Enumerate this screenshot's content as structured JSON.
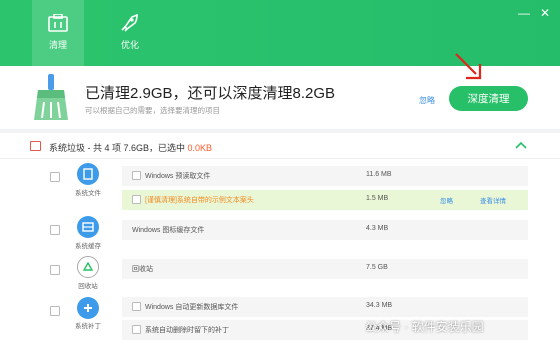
{
  "tabs": [
    {
      "label": "清理",
      "icon": "clean-icon",
      "active": true
    },
    {
      "label": "优化",
      "icon": "rocket-icon",
      "active": false
    }
  ],
  "window_controls": {
    "minimize": "—",
    "close": "✕"
  },
  "summary": {
    "title": "已清理2.9GB，还可以深度清理8.2GB",
    "subtitle": "可以根据自己的需要，选择要清理的项目",
    "ignore_link": "忽略",
    "deep_clean_button": "深度清理"
  },
  "section": {
    "title_prefix": "系统垃圾 - 共 4 项 7.6GB，已选中 ",
    "selected": "0.0KB"
  },
  "categories": [
    {
      "label": "系统文件",
      "icon": "system-file-icon"
    },
    {
      "label": "系统缓存",
      "icon": "system-cache-icon"
    },
    {
      "label": "回收站",
      "icon": "recycle-bin-icon"
    },
    {
      "label": "系统补丁",
      "icon": "system-patch-icon"
    }
  ],
  "rows": [
    {
      "name": "Windows 预读取文件",
      "size": "11.6 MB"
    },
    {
      "name": "[谨慎清理]系统自带的示例文本案头",
      "size": "1.5 MB",
      "action1": "忽略",
      "action2": "查看详情"
    },
    {
      "name": "Windows 图标缓存文件",
      "size": "4.3 MB"
    },
    {
      "name": "回收站",
      "size": "7.5 GB"
    },
    {
      "name": "Windows 自动更新数据库文件",
      "size": "34.3 MB"
    },
    {
      "name": "系统自动删除时留下的补丁",
      "size": "37.4 MB"
    }
  ],
  "watermark": "公众号 · 软件安装乐园",
  "colors": {
    "brand": "#27c068",
    "link": "#3a8ee6",
    "warning": "#f08a24",
    "selected": "#ff5a2a"
  }
}
